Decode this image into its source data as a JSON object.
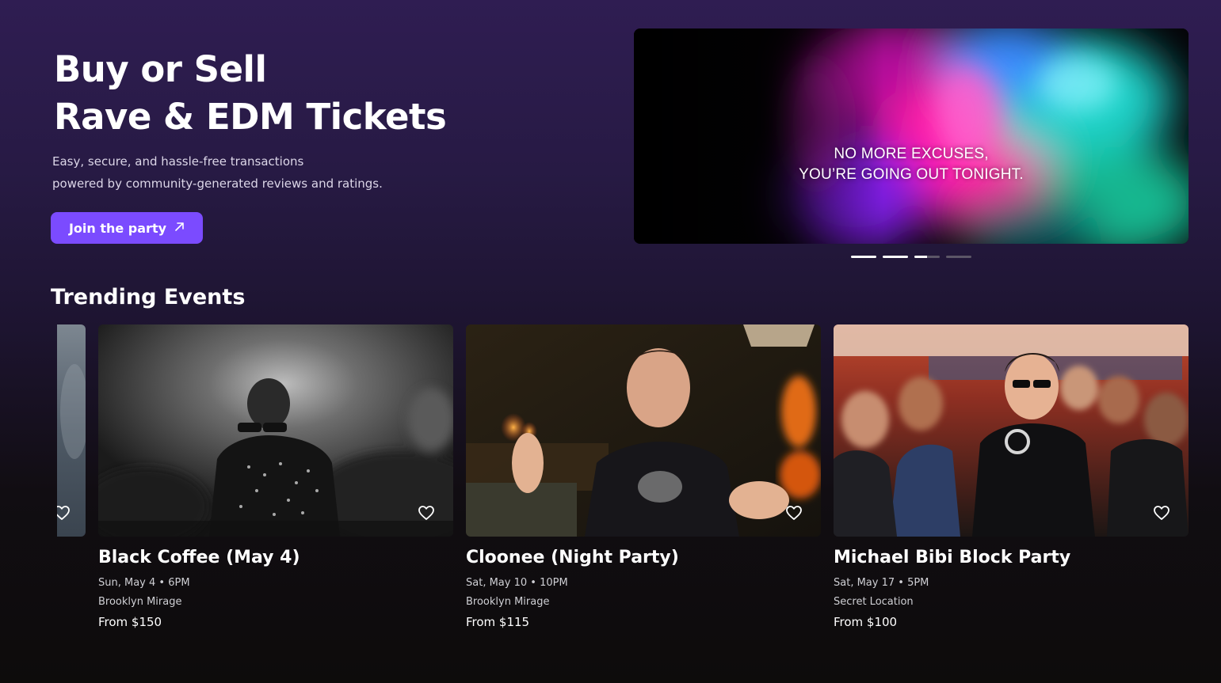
{
  "hero": {
    "title_line1": "Buy or Sell",
    "title_line2": "Rave & EDM Tickets",
    "subtitle_line1": "Easy, secure, and hassle-free transactions",
    "subtitle_line2": "powered by community-generated reviews and ratings.",
    "cta_label": "Join the party",
    "cta_icon": "arrow-up-right-icon",
    "accent_color": "#7b4bff"
  },
  "banner": {
    "line1": "NO MORE EXCUSES,",
    "line2": "YOU’RE GOING OUT TONIGHT.",
    "slide_count": 4,
    "active_slide": 3
  },
  "trending": {
    "title": "Trending Events",
    "events": [
      {
        "title": "Black Coffee (May 4)",
        "datetime": "Sun, May 4 • 6PM",
        "venue": "Brooklyn Mirage",
        "price": "From $150"
      },
      {
        "title": "Cloonee (Night Party)",
        "datetime": "Sat, May 10 • 10PM",
        "venue": "Brooklyn Mirage",
        "price": "From $115"
      },
      {
        "title": "Michael Bibi Block Party",
        "datetime": "Sat, May 17 • 5PM",
        "venue": "Secret Location",
        "price": "From $100"
      }
    ]
  }
}
